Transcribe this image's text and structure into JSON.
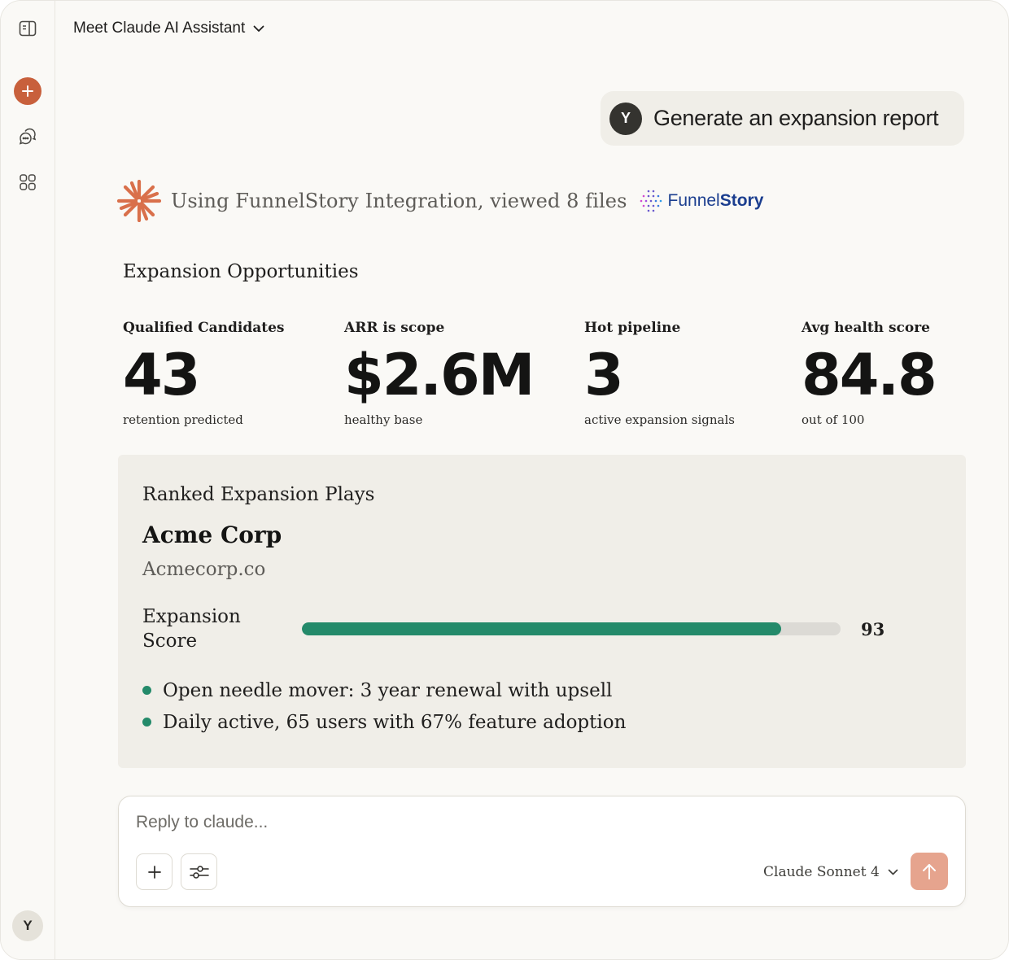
{
  "header": {
    "title": "Meet Claude AI Assistant"
  },
  "sidebar": {
    "icons": [
      "sidebar-toggle-icon",
      "plus-icon",
      "chat-bubbles-icon",
      "apps-grid-icon"
    ],
    "user_initial": "Y"
  },
  "user_message": {
    "avatar_initial": "Y",
    "text": "Generate an expansion report"
  },
  "integration": {
    "text": "Using FunnelStory Integration, viewed 8 files",
    "logo_word_1": "Funnel",
    "logo_word_2": "Story"
  },
  "section_title": "Expansion Opportunities",
  "stats": [
    {
      "label": "Qualified Candidates",
      "value": "43",
      "sub": "retention predicted"
    },
    {
      "label": "ARR is scope",
      "value": "$2.6M",
      "sub": "healthy base"
    },
    {
      "label": "Hot pipeline",
      "value": "3",
      "sub": "active expansion signals"
    },
    {
      "label": "Avg health score",
      "value": "84.8",
      "sub": "out of 100"
    }
  ],
  "card": {
    "title": "Ranked Expansion Plays",
    "company": "Acme Corp",
    "url": "Acmecorp.co",
    "score_label": "Expansion Score",
    "score_value": "93",
    "score_fraction": 0.89,
    "bullets": [
      "Open needle mover: 3 year renewal with upsell",
      "Daily active, 65 users with 67% feature adoption"
    ]
  },
  "composer": {
    "placeholder": "Reply to claude...",
    "model": "Claude Sonnet 4"
  },
  "colors": {
    "accent": "#c8603c",
    "score_green": "#248a6a",
    "send_button": "#e6a48e",
    "funnelstory_blue": "#1b3e8f"
  }
}
